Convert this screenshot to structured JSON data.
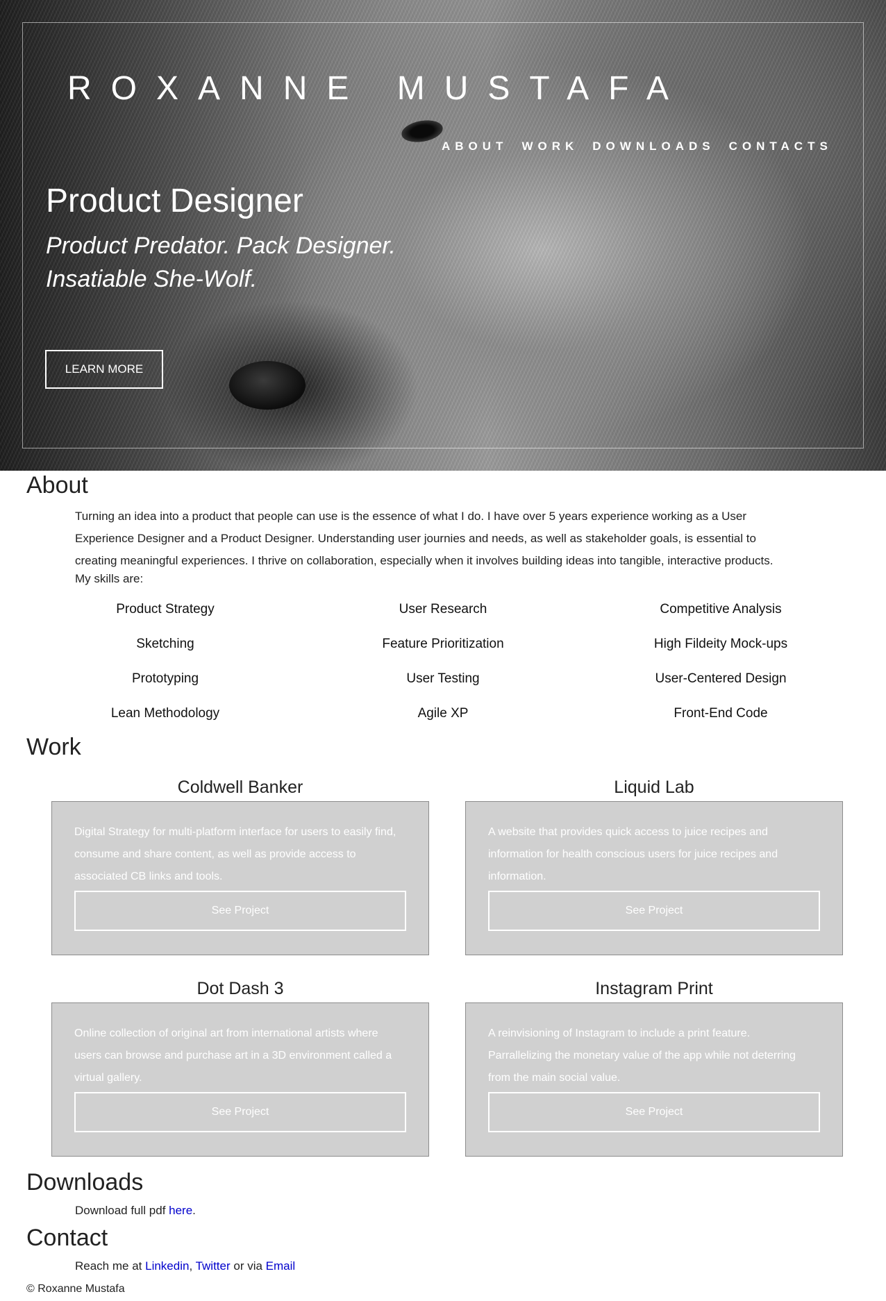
{
  "hero": {
    "brand": "ROXANNE MUSTAFA",
    "nav": [
      "ABOUT",
      "WORK",
      "DOWNLOADS",
      "CONTACTS"
    ],
    "title": "Product Designer",
    "tagline_1": "Product Predator. Pack Designer.",
    "tagline_2": "Insatiable She-Wolf.",
    "cta": "LEARN MORE"
  },
  "about": {
    "heading": "About",
    "paragraph": "Turning an idea into a product that people can use is the essence of what I do. I have over 5 years experience working as a User Experience Designer and a Product Designer. Understanding user journies and needs, as well as stakeholder goals, is essential to creating meaningful experiences. I thrive on collaboration, especially when it involves building ideas into tangible, interactive products.",
    "skills_label": "My skills are:",
    "skills": [
      "Product Strategy",
      "User Research",
      "Competitive Analysis",
      "Sketching",
      "Feature Prioritization",
      "High Fildeity Mock-ups",
      "Prototyping",
      "User Testing",
      "User-Centered Design",
      "Lean Methodology",
      "Agile XP",
      "Front-End Code"
    ]
  },
  "work": {
    "heading": "Work",
    "projects": [
      {
        "title": "Coldwell Banker",
        "description": "Digital Strategy for multi-platform interface for users to easily find, consume and share content, as well as provide access to associated CB links and tools.",
        "button": "See Project"
      },
      {
        "title": "Liquid Lab",
        "description": "A website that provides quick access to juice recipes and information for health conscious users for juice recipes and information.",
        "button": "See Project"
      },
      {
        "title": "Dot Dash 3",
        "description": "Online collection of original art from international artists where users can browse and purchase art in a 3D environment called a virtual gallery.",
        "button": "See Project"
      },
      {
        "title": "Instagram Print",
        "description": "A reinvisioning of Instagram to include a print feature. Parrallelizing the monetary value of the app while not deterring from the main social value.",
        "button": "See Project"
      }
    ]
  },
  "downloads": {
    "heading": "Downloads",
    "text_before": "Download full pdf ",
    "link": "here",
    "text_after": "."
  },
  "contact": {
    "heading": "Contact",
    "text_before": "Reach me at ",
    "linkedin": "Linkedin",
    "comma": ", ",
    "twitter": "Twitter",
    "middle": " or via ",
    "email": "Email"
  },
  "footer": "© Roxanne Mustafa",
  "colors": {
    "card_bg": "#d0d0d0",
    "link": "#0000cc",
    "hero_text": "#ffffff"
  }
}
